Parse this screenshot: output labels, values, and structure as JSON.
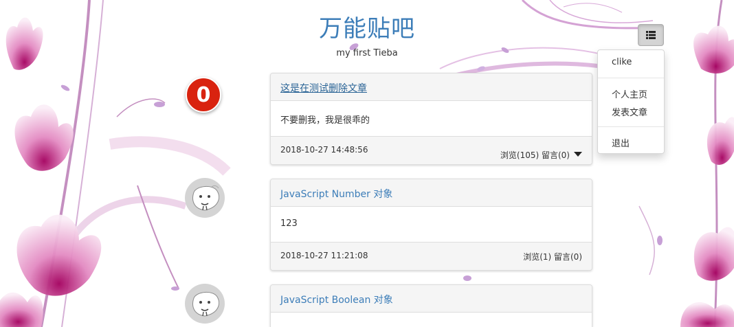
{
  "site": {
    "title": "万能贴吧",
    "subtitle": "my first Tieba"
  },
  "menu": {
    "toggle_icon": "list-icon",
    "items": [
      {
        "label": "clike"
      },
      {
        "label": "个人主页"
      },
      {
        "label": "发表文章"
      },
      {
        "label": "退出"
      }
    ]
  },
  "posts": [
    {
      "badge": "0",
      "title": "这是在测试删除文章",
      "body": "不要删我，我是很乖的",
      "date": "2018-10-27 14:48:56",
      "stats": "浏览(105) 留言(0)"
    },
    {
      "avatar_icon": "cartoon-face-avatar-icon",
      "title": "JavaScript Number 对象",
      "body": "123",
      "date": "2018-10-27 11:21:08",
      "stats": "浏览(1) 留言(0)"
    },
    {
      "avatar_icon": "cartoon-face-avatar-icon",
      "title": "JavaScript Boolean 对象"
    }
  ],
  "colors": {
    "accent": "#3c7db8",
    "badge": "#d9230f",
    "flower": "#b0408c"
  }
}
